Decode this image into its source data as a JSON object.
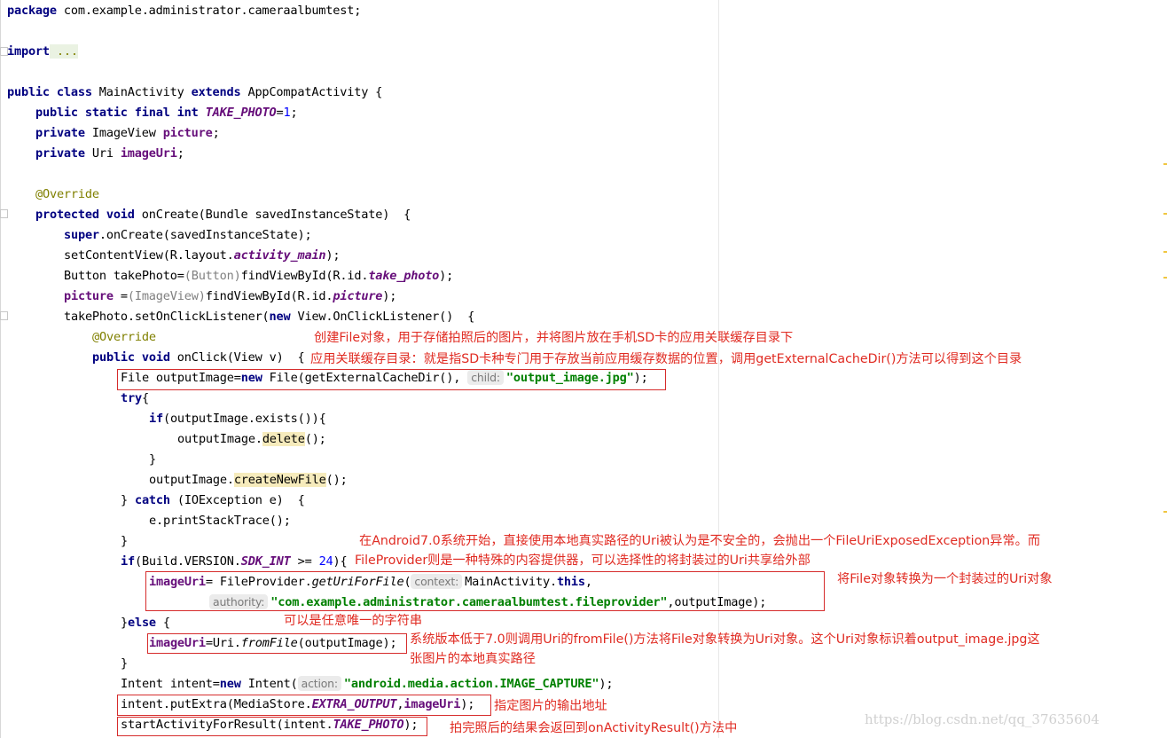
{
  "code": {
    "package_kw": "package",
    "package_name": " com.example.administrator.cameraalbumtest;",
    "import_kw": "import",
    "import_fold": " ...",
    "class_line": {
      "kw1": "public class",
      "name": " MainActivity ",
      "kw2": "extends",
      "rest": " AppCompatActivity {"
    },
    "take_photo_decl": {
      "kw": "public static final int",
      "field": " TAKE_PHOTO",
      "eq": "=",
      "num": "1",
      "semi": ";"
    },
    "picture_decl": {
      "kw": "private",
      "type": " ImageView ",
      "field": "picture",
      "semi": ";"
    },
    "uri_decl": {
      "kw": "private",
      "type": " Uri ",
      "field": "imageUri",
      "semi": ";"
    },
    "override1": "@Override",
    "oncreate_sig": {
      "kw": "protected void",
      "rest": " onCreate(Bundle savedInstanceState)  {"
    },
    "super_call": {
      "kw": "super",
      "rest": ".onCreate(savedInstanceState);"
    },
    "set_content": {
      "pre": "setContentView(R.layout.",
      "field": "activity_main",
      "post": ");"
    },
    "button_line": {
      "pre": "Button takePhoto=",
      "cast": "(Button)",
      "mid": "findViewById(R.id.",
      "field": "take_photo",
      "post": ");"
    },
    "picture_line": {
      "field": "picture",
      "pre": " =",
      "cast": "(ImageView)",
      "mid": "findViewById(R.id.",
      "field2": "picture",
      "post": ");"
    },
    "listener_line": {
      "pre": "takePhoto.setOnClickListener(",
      "kw": "new",
      "post": " View.OnClickListener()  {"
    },
    "override2": "@Override",
    "onclick_sig": {
      "kw": "public void",
      "rest": " onClick(View v)  {"
    },
    "file_line": {
      "pre": "File outputImage=",
      "kw": "new",
      "mid": " File(getExternalCacheDir(), ",
      "hint": "child:",
      "str": "\"output_image.jpg\"",
      "post": ");"
    },
    "try_kw": "try",
    "try_brace": "{",
    "if_exists": {
      "kw": "if",
      "rest": "(outputImage.exists()){"
    },
    "delete_line": {
      "pre": "outputImage.",
      "warn": "delete",
      "post": "();"
    },
    "close_brace": "}",
    "create_line": {
      "pre": "outputImage.",
      "warn": "createNewFile",
      "post": "();"
    },
    "catch_line": {
      "pre": "} ",
      "kw": "catch",
      "post": " (IOException e)  {"
    },
    "print_trace": "e.printStackTrace();",
    "if_sdk": {
      "kw": "if",
      "pre": "(Build.VERSION.",
      "field": "SDK_INT",
      "mid": " >= ",
      "num": "24",
      "post": "){"
    },
    "fp_line1": {
      "field": "imageUri",
      "pre": "= FileProvider.",
      "ital": "getUriForFile",
      "open": "(",
      "hint": "context:",
      "ctx": "MainActivity.",
      "kw": "this",
      "comma": ","
    },
    "fp_line2": {
      "hint": "authority:",
      "str": "\"com.example.administrator.cameraalbumtest.fileprovider\"",
      "post": ",outputImage);"
    },
    "else_line": {
      "pre": "}",
      "kw": "else",
      "post": " {"
    },
    "fromfile_line": {
      "field": "imageUri",
      "pre": "=Uri.",
      "ital": "fromFile",
      "post": "(outputImage);"
    },
    "intent_line": {
      "pre": "Intent intent=",
      "kw": "new",
      "mid": " Intent(",
      "hint": "action:",
      "str": "\"android.media.action.IMAGE_CAPTURE\"",
      "post": ");"
    },
    "putextra_line": {
      "pre": "intent.putExtra(MediaStore.",
      "sfield": "EXTRA_OUTPUT",
      "comma": ",",
      "field": "imageUri",
      "post": ");"
    },
    "start_line": {
      "pre": "startActivityForResult(intent.",
      "sfield": "TAKE_PHOTO",
      "post": ");"
    }
  },
  "notes": {
    "n1": "创建File对象，用于存储拍照后的图片，并将图片放在手机SD卡的应用关联缓存目录下",
    "n2": "应用关联缓存目录：就是指SD卡种专门用于存放当前应用缓存数据的位置，调用getExternalCacheDir()方法可以得到这个目录",
    "n3": "在Android7.0系统开始，直接使用本地真实路径的Uri被认为是不安全的，会抛出一个FileUriExposedException异常。而",
    "n4": "FileProvider则是一种特殊的内容提供器，可以选择性的将封装过的Uri共享给外部",
    "n5": "将File对象转换为一个封装过的Uri对象",
    "n6": "可以是任意唯一的字符串",
    "n7": "系统版本低于7.0则调用Uri的fromFile()方法将File对象转换为Uri对象。这个Uri对象标识着output_image.jpg这",
    "n8": "张图片的本地真实路径",
    "n9": "指定图片的输出地址",
    "n10": "拍完照后的结果会返回到onActivityResult()方法中"
  },
  "watermark": "https://blog.csdn.net/qq_37635604",
  "colors": {
    "keyword": "#000080",
    "field": "#660e7a",
    "annotation": "#808000",
    "string": "#008000",
    "note": "#e02b22"
  }
}
